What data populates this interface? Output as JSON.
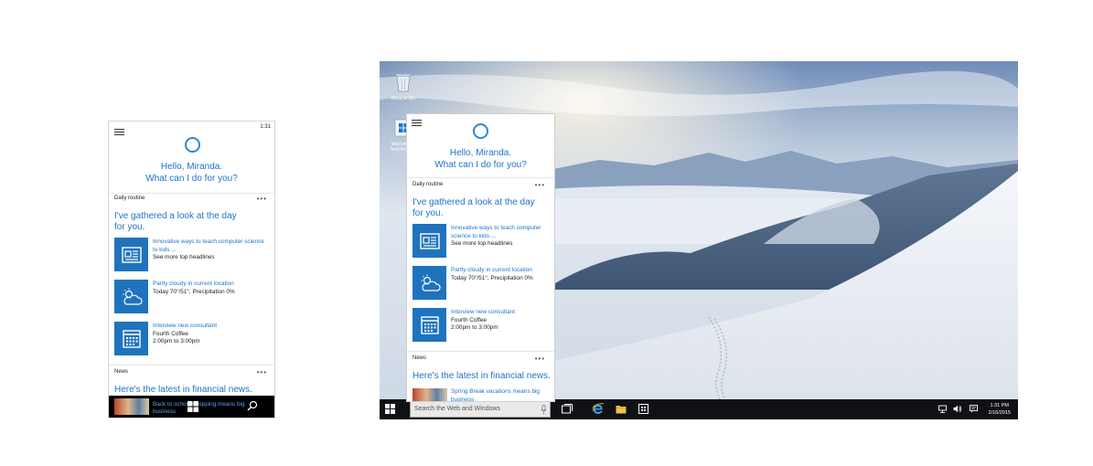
{
  "phone": {
    "status_time": "1:31",
    "greeting_line1": "Hello, Miranda.",
    "greeting_line2": "What can I do for you?",
    "daily_routine": {
      "header": "Daily routine",
      "more": "•••",
      "title_line1": "I've gathered a look at the day",
      "title_line2": "for you.",
      "items": [
        {
          "icon": "newspaper-icon",
          "link": "Innovative ways to teach computer science to kids ...",
          "line2": "See more top headlines",
          "line3": ""
        },
        {
          "icon": "weather-cloud-icon",
          "link": "Partly cloudy in current location",
          "line2": "Today 70°/51°, Precipitation 0%",
          "line3": ""
        },
        {
          "icon": "calendar-icon",
          "link": "Interview new consultant",
          "line2": "Fourth Coffee",
          "line3": "2:00pm to 3:00pm"
        }
      ]
    },
    "news": {
      "header": "News",
      "more": "•••",
      "title": "Here's the latest in financial news.",
      "item_link": "Back to school shopping means big business"
    }
  },
  "desktop": {
    "icons": [
      {
        "label": "Recycle Bin"
      },
      {
        "label": "Welcome to Tech Preview"
      }
    ],
    "cortana": {
      "greeting_line1": "Hello, Miranda.",
      "greeting_line2": "What can I do for you?",
      "daily_routine": {
        "header": "Daily routine",
        "more": "•••",
        "title_line1": "I've gathered a look at the day",
        "title_line2": "for you.",
        "items": [
          {
            "icon": "newspaper-icon",
            "link": "Innovative ways to teach computer science to kids ...",
            "line2": "See more top headlines",
            "line3": ""
          },
          {
            "icon": "weather-cloud-icon",
            "link": "Partly cloudy in current location",
            "line2": "Today 70°/51°, Precipitation 0%",
            "line3": ""
          },
          {
            "icon": "calendar-icon",
            "link": "Interview new consultant",
            "line2": "Fourth Coffee",
            "line3": "2:00pm to 3:00pm"
          }
        ]
      },
      "news": {
        "header": "News",
        "more": "•••",
        "title": "Here's the latest in financial news.",
        "item_link": "Spring Break vacations means big business"
      }
    },
    "taskbar": {
      "search_placeholder": "Search the Web and Windows",
      "time": "1:31 PM",
      "date": "2/16/2015"
    }
  },
  "colors": {
    "accent": "#1e74c7",
    "tile": "#1f73bd",
    "taskbar": "#0f1115"
  }
}
